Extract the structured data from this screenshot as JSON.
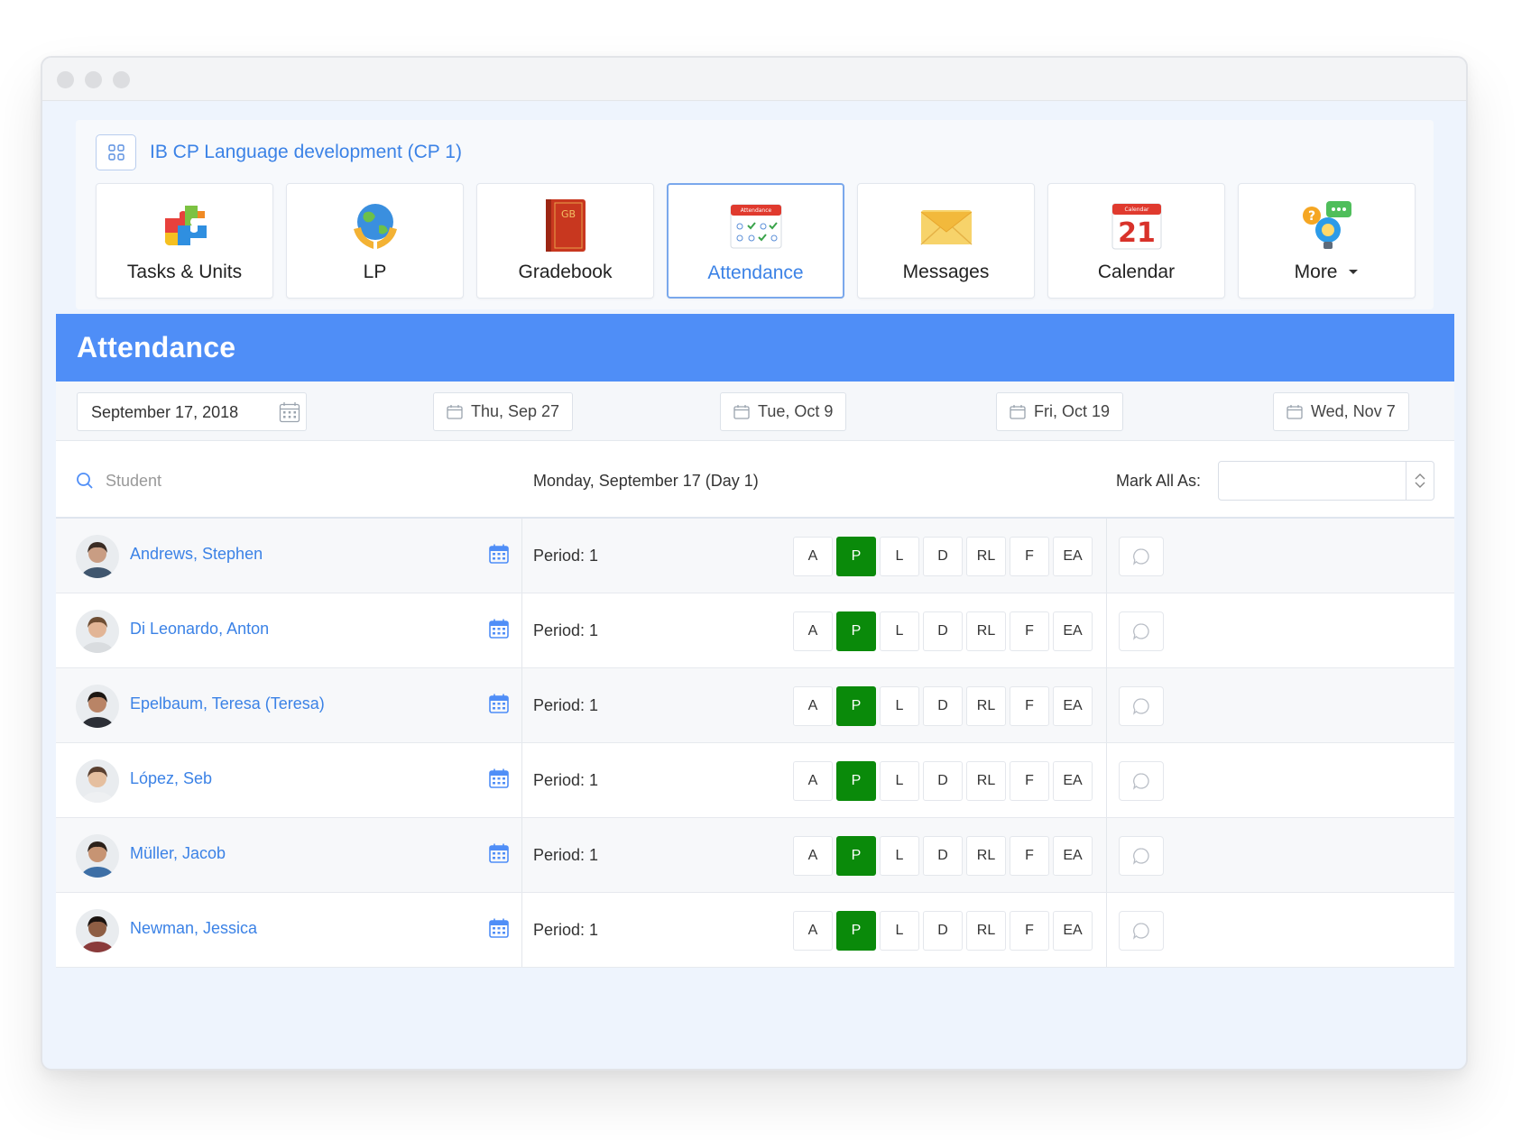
{
  "course": {
    "title": "IB CP Language development (CP 1)",
    "grid_icon": "grid-icon"
  },
  "tiles": [
    {
      "label": "Tasks & Units",
      "icon": "puzzle-icon",
      "active": false
    },
    {
      "label": "LP",
      "icon": "globe-hands-icon",
      "active": false
    },
    {
      "label": "Gradebook",
      "icon": "gradebook-book-icon",
      "icon_text": "GB",
      "active": false
    },
    {
      "label": "Attendance",
      "icon": "attendance-sheet-icon",
      "icon_text": "Attendance",
      "active": true
    },
    {
      "label": "Messages",
      "icon": "envelope-icon",
      "active": false
    },
    {
      "label": "Calendar",
      "icon": "calendar-21-icon",
      "icon_text": "21",
      "icon_header_text": "Calendar",
      "active": false
    },
    {
      "label": "More",
      "icon": "lightbulb-chat-icon",
      "active": false,
      "has_dropdown": true
    }
  ],
  "attendance": {
    "title": "Attendance",
    "date_value": "September 17, 2018",
    "date_buttons": [
      "Thu, Sep 27",
      "Tue, Oct 9",
      "Fri, Oct 19",
      "Wed, Nov 7"
    ],
    "search_placeholder": "Student",
    "day_label": "Monday, September 17 (Day 1)",
    "mark_all_label": "Mark All As:",
    "mark_all_value": ""
  },
  "codes": [
    "A",
    "P",
    "L",
    "D",
    "RL",
    "F",
    "EA"
  ],
  "colors": {
    "accent": "#4f8ef7",
    "link": "#3b82e6",
    "present": "#0a8a0a"
  },
  "students": [
    {
      "name": "Andrews, Stephen",
      "period": "Period: 1",
      "status": "P"
    },
    {
      "name": "Di Leonardo, Anton",
      "period": "Period: 1",
      "status": "P"
    },
    {
      "name": "Epelbaum, Teresa (Teresa)",
      "period": "Period: 1",
      "status": "P"
    },
    {
      "name": "López, Seb",
      "period": "Period: 1",
      "status": "P"
    },
    {
      "name": "Müller, Jacob",
      "period": "Period: 1",
      "status": "P"
    },
    {
      "name": "Newman, Jessica",
      "period": "Period: 1",
      "status": "P"
    }
  ]
}
